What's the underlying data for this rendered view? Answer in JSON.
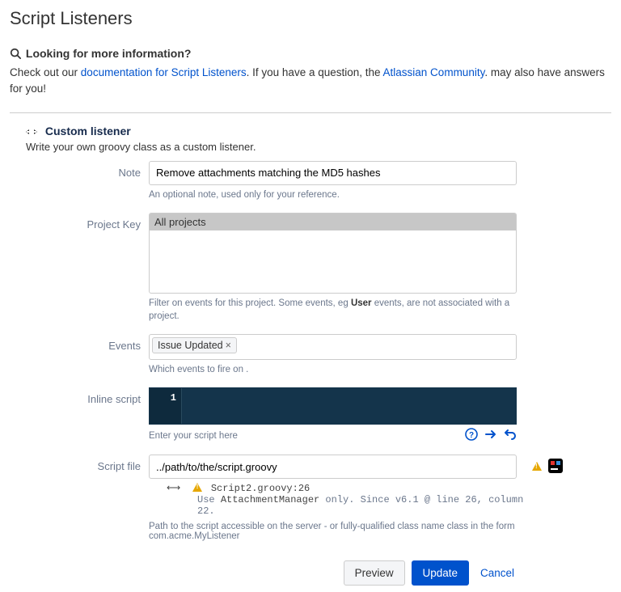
{
  "page": {
    "title": "Script Listeners"
  },
  "info": {
    "heading": "Looking for more information?",
    "prefix": "Check out our ",
    "doc_link": "documentation for Script Listeners",
    "mid1": ". If you have a question, the ",
    "community_link": "Atlassian Community",
    "suffix": ". may also have answers for you!"
  },
  "section": {
    "title": "Custom listener",
    "subtitle": "Write your own groovy class as a custom listener."
  },
  "labels": {
    "note": "Note",
    "project_key": "Project Key",
    "events": "Events",
    "inline_script": "Inline script",
    "script_file": "Script file"
  },
  "note": {
    "value": "Remove attachments matching the MD5 hashes",
    "help": "An optional note, used only for your reference."
  },
  "project_key": {
    "selected": "All projects",
    "help_pre": "Filter on events for this project. Some events, eg ",
    "help_bold": "User",
    "help_post": " events, are not associated with a project."
  },
  "events": {
    "tag": "Issue Updated",
    "help": "Which events to fire on ."
  },
  "inline": {
    "gutter": "1",
    "help": "Enter your script here"
  },
  "script_file": {
    "value": "../path/to/the/script.groovy",
    "msg_file": "Script2.groovy:26",
    "msg_hint_pre": "Use ",
    "msg_hint_kw": "AttachmentManager",
    "msg_hint_post": " only. Since v6.1 @ line 26, column 22.",
    "path_help": "Path to the script accessible on the server - or fully-qualified class name class in the form com.acme.MyListener"
  },
  "buttons": {
    "preview": "Preview",
    "update": "Update",
    "cancel": "Cancel"
  }
}
